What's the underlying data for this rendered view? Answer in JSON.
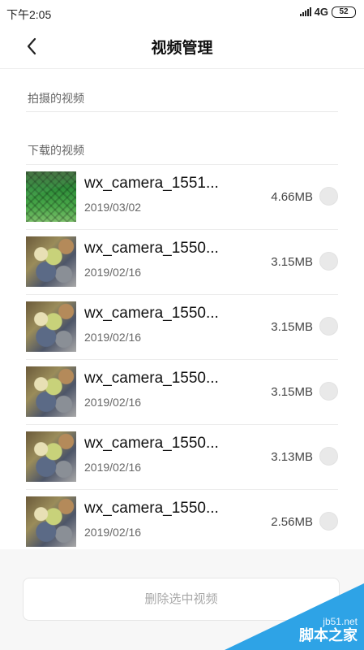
{
  "status_bar": {
    "time": "下午2:05",
    "network": "4G",
    "battery": "52"
  },
  "header": {
    "back_icon": "chevron-left-icon",
    "title": "视频管理"
  },
  "sections": {
    "recorded_label": "拍摄的视频",
    "downloaded_label": "下载的视频"
  },
  "videos": [
    {
      "name": "wx_camera_1551...",
      "date": "2019/03/02",
      "size": "4.66MB",
      "selected": false
    },
    {
      "name": "wx_camera_1550...",
      "date": "2019/02/16",
      "size": "3.15MB",
      "selected": false
    },
    {
      "name": "wx_camera_1550...",
      "date": "2019/02/16",
      "size": "3.15MB",
      "selected": false
    },
    {
      "name": "wx_camera_1550...",
      "date": "2019/02/16",
      "size": "3.15MB",
      "selected": false
    },
    {
      "name": "wx_camera_1550...",
      "date": "2019/02/16",
      "size": "3.13MB",
      "selected": false
    },
    {
      "name": "wx_camera_1550...",
      "date": "2019/02/16",
      "size": "2.56MB",
      "selected": false
    }
  ],
  "actions": {
    "delete_label": "删除选中视频"
  },
  "watermark": {
    "url": "jb51.net",
    "name": "脚本之家",
    "color": "#2ea3e6"
  }
}
